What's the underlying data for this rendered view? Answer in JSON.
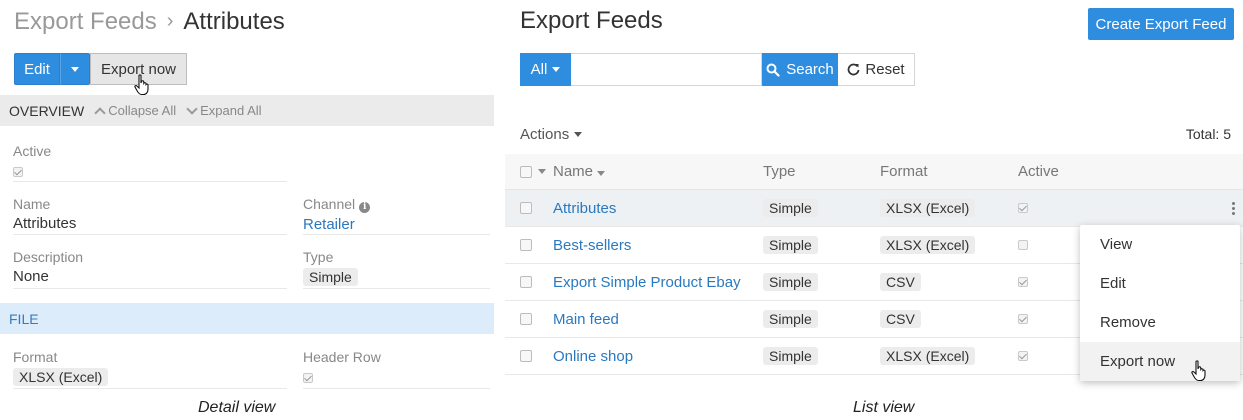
{
  "detail": {
    "breadcrumb": {
      "parent": "Export Feeds",
      "separator": "›",
      "current": "Attributes"
    },
    "buttons": {
      "edit": "Edit",
      "export_now": "Export now"
    },
    "overview": {
      "title": "OVERVIEW",
      "collapse_all": "Collapse All",
      "expand_all": "Expand All"
    },
    "fields": {
      "active_label": "Active",
      "active_value": true,
      "name_label": "Name",
      "name_value": "Attributes",
      "channel_label": "Channel",
      "channel_value": "Retailer",
      "description_label": "Description",
      "description_value": "None",
      "type_label": "Type",
      "type_value": "Simple"
    },
    "file_section": {
      "title": "FILE"
    },
    "file_fields": {
      "format_label": "Format",
      "format_value": "XLSX (Excel)",
      "header_row_label": "Header Row",
      "header_row_value": true
    },
    "caption": "Detail view"
  },
  "list": {
    "title": "Export Feeds",
    "create_button": "Create Export Feed",
    "search": {
      "filter_label": "All",
      "placeholder": "",
      "search_button": "Search",
      "reset_button": "Reset"
    },
    "actions_label": "Actions",
    "total_label": "Total: 5",
    "columns": {
      "name": "Name",
      "type": "Type",
      "format": "Format",
      "active": "Active"
    },
    "rows": [
      {
        "name": "Attributes",
        "type": "Simple",
        "format": "XLSX (Excel)",
        "active": true
      },
      {
        "name": "Best-sellers",
        "type": "Simple",
        "format": "XLSX (Excel)",
        "active": false
      },
      {
        "name": "Export Simple Product Ebay",
        "type": "Simple",
        "format": "CSV",
        "active": true
      },
      {
        "name": "Main feed",
        "type": "Simple",
        "format": "CSV",
        "active": true
      },
      {
        "name": "Online shop",
        "type": "Simple",
        "format": "XLSX (Excel)",
        "active": true
      }
    ],
    "row_menu": [
      "View",
      "Edit",
      "Remove",
      "Export now"
    ],
    "caption": "List view"
  },
  "colors": {
    "primary": "#2f8ddf",
    "link": "#2a79c0",
    "section_bg": "#ebebeb",
    "file_section_bg": "#ddecfa"
  },
  "icons": [
    "caret-down-icon",
    "chevron-up-icon",
    "chevron-down-icon",
    "info-icon",
    "search-icon",
    "reset-icon",
    "kebab-icon",
    "hand-cursor-icon"
  ]
}
